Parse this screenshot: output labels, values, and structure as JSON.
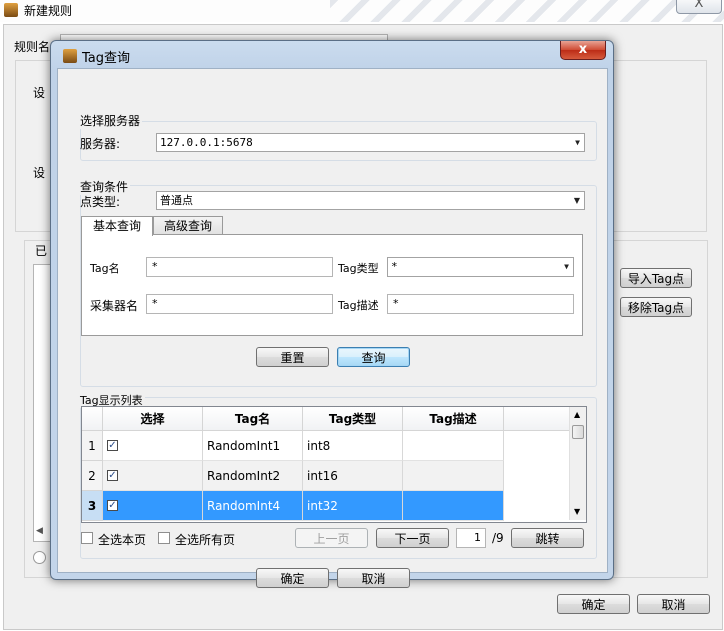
{
  "outer": {
    "title": "新建规则",
    "close_glyph": "X",
    "rule_name_label": "规则名",
    "set_label_1": "设",
    "set_label_2": "设",
    "list_label": "已",
    "import_button": "导入Tag点",
    "remove_button": "移除Tag点",
    "ok_button": "确定",
    "cancel_button": "取消"
  },
  "dialog": {
    "title": "Tag查询",
    "close_glyph": "x",
    "server_group": {
      "label": "选择服务器",
      "server_label": "服务器:",
      "server_value": "127.0.0.1:5678"
    },
    "query_group": {
      "label": "查询条件",
      "point_type_label": "点类型:",
      "point_type_value": "普通点",
      "tabs": [
        {
          "label": "基本查询",
          "active": true
        },
        {
          "label": "高级查询",
          "active": false
        }
      ],
      "tag_name_label": "Tag名",
      "tag_name_value": "*",
      "tag_type_label": "Tag类型",
      "tag_type_value": "*",
      "collector_label": "采集器名",
      "collector_value": "*",
      "tag_desc_label": "Tag描述",
      "tag_desc_value": "*",
      "reset_button": "重置",
      "query_button": "查询"
    },
    "list_group": {
      "label": "Tag显示列表",
      "columns": [
        "选择",
        "Tag名",
        "Tag类型",
        "Tag描述"
      ],
      "rows": [
        {
          "num": "1",
          "checked": true,
          "name": "RandomInt1",
          "type": "int8",
          "desc": ""
        },
        {
          "num": "2",
          "checked": true,
          "name": "RandomInt2",
          "type": "int16",
          "desc": ""
        },
        {
          "num": "3",
          "checked": true,
          "name": "RandomInt4",
          "type": "int32",
          "desc": ""
        }
      ],
      "select_page_label": "全选本页",
      "select_all_label": "全选所有页",
      "prev_button": "上一页",
      "next_button": "下一页",
      "page_value": "1",
      "page_total": "/9",
      "jump_button": "跳转"
    },
    "ok_button": "确定",
    "cancel_button": "取消"
  },
  "colors": {
    "selection": "#3399ff",
    "close_button": "#c9452f"
  }
}
